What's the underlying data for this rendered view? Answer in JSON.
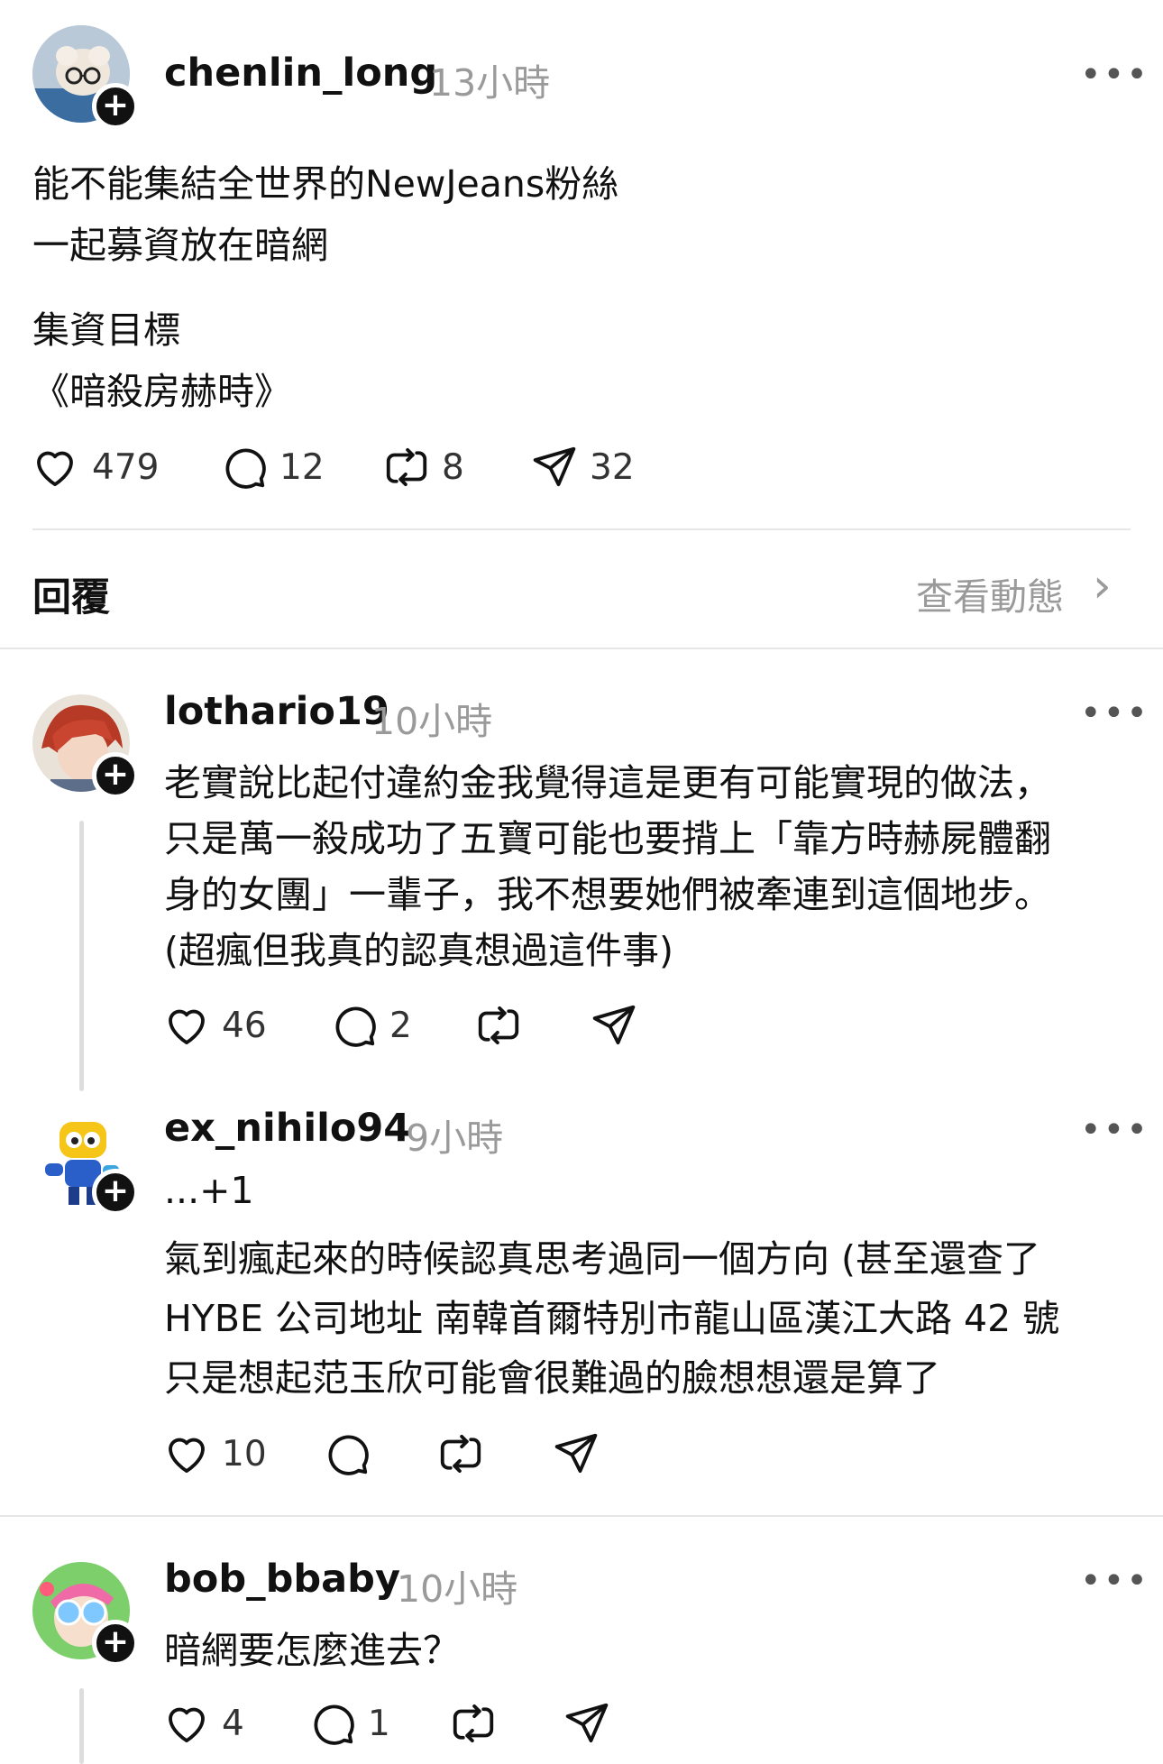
{
  "main_post": {
    "username": "chenlin_long",
    "time": "13小時",
    "more": "•••",
    "lines": [
      "能不能集結全世界的NewJeans粉絲",
      "一起募資放在暗網",
      "集資目標",
      "《暗殺房赫時》"
    ],
    "likes": "479",
    "comments": "12",
    "reposts": "8",
    "shares": "32"
  },
  "replies_header": {
    "title": "回覆",
    "activity_link": "查看動態",
    "chevron": "›"
  },
  "replies": [
    {
      "username": "lothario19",
      "time": "10小時",
      "more": "•••",
      "lines": [
        "老實說比起付違約金我覺得這是更有可能實現的做法，",
        "只是萬一殺成功了五寶可能也要揹上「靠方時赫屍體翻",
        "身的女團」一輩子，我不想要她們被牽連到這個地步。",
        "(超瘋但我真的認真想過這件事)"
      ],
      "likes": "46",
      "comments": "2"
    },
    {
      "username": "ex_nihilo94",
      "time": "9小時",
      "more": "•••",
      "lines": [
        "...+1",
        "氣到瘋起來的時候認真思考過同一個方向 (甚至還查了",
        "HYBE 公司地址 南韓首爾特別市龍山區漢江大路 42 號",
        "只是想起范玉欣可能會很難過的臉想想還是算了"
      ],
      "likes": "10"
    },
    {
      "username": "bob_bbaby",
      "time": "10小時",
      "more": "•••",
      "lines": [
        "暗網要怎麼進去？"
      ],
      "likes": "4",
      "comments": "1"
    }
  ],
  "colors": {
    "text": "#111111",
    "muted": "#9a9a9a",
    "divider": "#e6e6e6"
  }
}
